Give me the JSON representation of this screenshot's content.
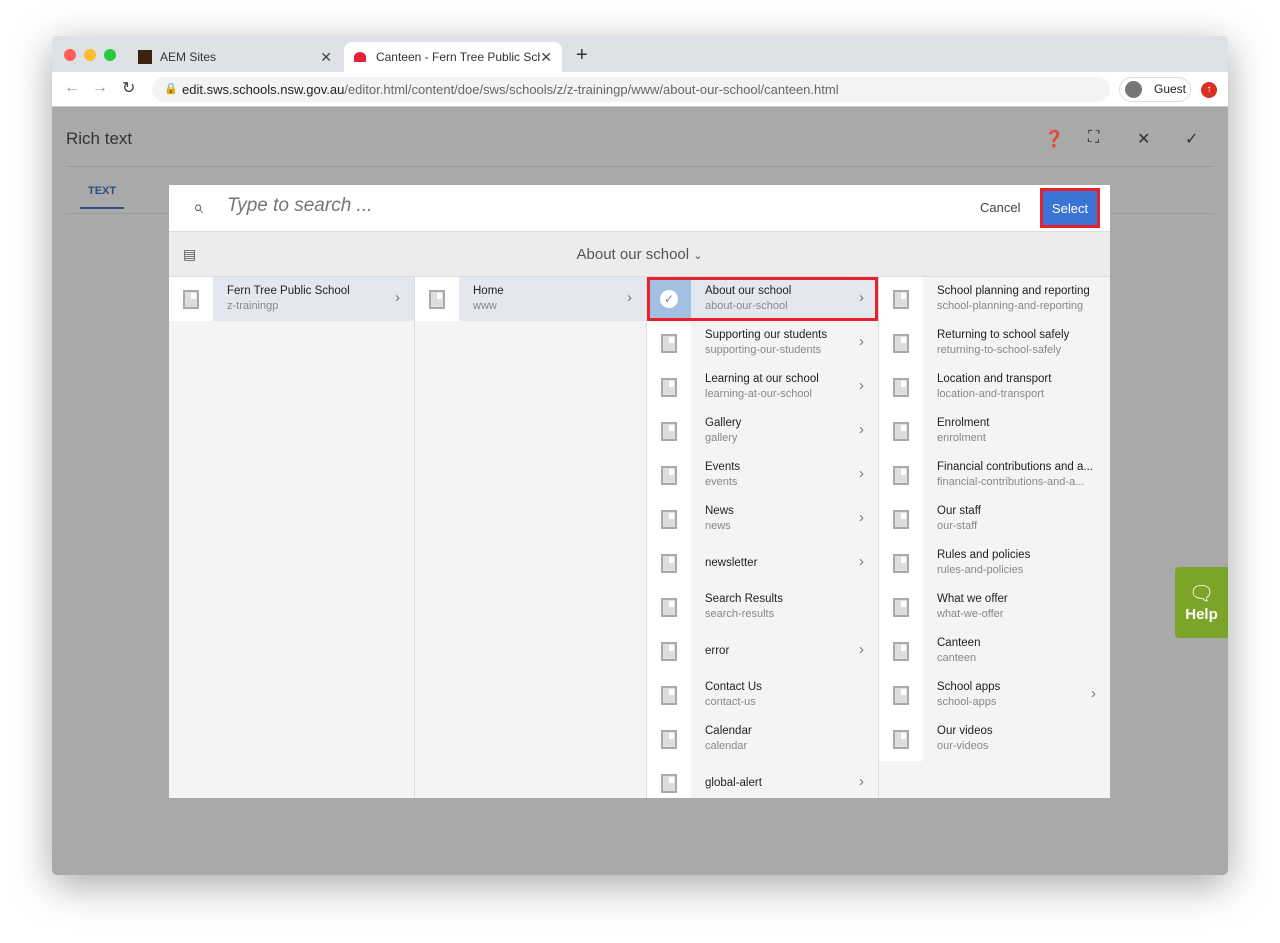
{
  "browser": {
    "tabs": [
      {
        "label": "AEM Sites"
      },
      {
        "label": "Canteen - Fern Tree Public Sch"
      }
    ],
    "url_host": "edit.sws.schools.nsw.gov.au",
    "url_path": "/editor.html/content/doe/sws/schools/z/z-trainingp/www/about-our-school/canteen.html",
    "profile": "Guest"
  },
  "editor": {
    "title": "Rich text",
    "tab": "TEXT"
  },
  "picker": {
    "search_placeholder": "Type to search ...",
    "cancel": "Cancel",
    "select": "Select",
    "breadcrumb": "About our school",
    "col1": [
      {
        "title": "Fern Tree Public School",
        "name": "z-trainingp",
        "children": true
      }
    ],
    "col2": [
      {
        "title": "Home",
        "name": "www",
        "children": true
      }
    ],
    "col3": [
      {
        "title": "About our school",
        "name": "about-our-school",
        "children": true
      },
      {
        "title": "Supporting our students",
        "name": "supporting-our-students",
        "children": true
      },
      {
        "title": "Learning at our school",
        "name": "learning-at-our-school",
        "children": true
      },
      {
        "title": "Gallery",
        "name": "gallery",
        "children": true
      },
      {
        "title": "Events",
        "name": "events",
        "children": true
      },
      {
        "title": "News",
        "name": "news",
        "children": true
      },
      {
        "title": "newsletter",
        "name": "",
        "children": true
      },
      {
        "title": "Search Results",
        "name": "search-results",
        "children": false
      },
      {
        "title": "error",
        "name": "",
        "children": true
      },
      {
        "title": "Contact Us",
        "name": "contact-us",
        "children": false
      },
      {
        "title": "Calendar",
        "name": "calendar",
        "children": false
      },
      {
        "title": "global-alert",
        "name": "",
        "children": true
      }
    ],
    "col4": [
      {
        "title": "School planning and reporting",
        "name": "school-planning-and-reporting",
        "children": false
      },
      {
        "title": "Returning to school safely",
        "name": "returning-to-school-safely",
        "children": false
      },
      {
        "title": "Location and transport",
        "name": "location-and-transport",
        "children": false
      },
      {
        "title": "Enrolment",
        "name": "enrolment",
        "children": false
      },
      {
        "title": "Financial contributions and a...",
        "name": "financial-contributions-and-a...",
        "children": false
      },
      {
        "title": "Our staff",
        "name": "our-staff",
        "children": false
      },
      {
        "title": "Rules and policies",
        "name": "rules-and-policies",
        "children": false
      },
      {
        "title": "What we offer",
        "name": "what-we-offer",
        "children": false
      },
      {
        "title": "Canteen",
        "name": "canteen",
        "children": false
      },
      {
        "title": "School apps",
        "name": "school-apps",
        "children": true
      },
      {
        "title": "Our videos",
        "name": "our-videos",
        "children": false
      }
    ]
  },
  "help": {
    "label": "Help"
  }
}
